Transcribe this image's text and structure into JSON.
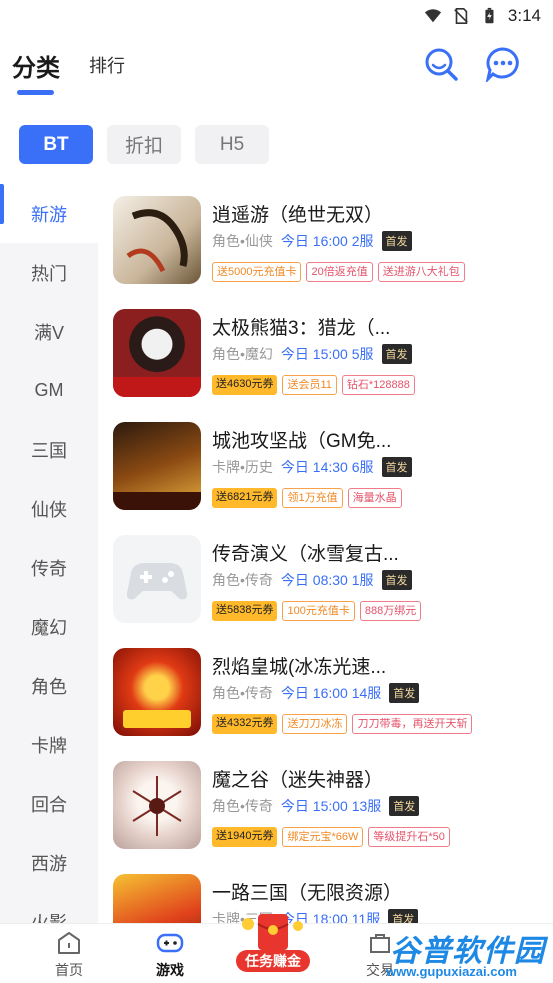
{
  "status_bar": {
    "time": "3:14"
  },
  "header": {
    "active_tab": "分类",
    "second_tab": "排行",
    "search_icon": "search-icon",
    "message_icon": "chat-bubble-icon"
  },
  "filters": [
    {
      "label": "BT",
      "active": true
    },
    {
      "label": "折扣",
      "active": false
    },
    {
      "label": "H5",
      "active": false
    }
  ],
  "categories": [
    "新游",
    "热门",
    "满V",
    "GM",
    "三国",
    "仙侠",
    "传奇",
    "魔幻",
    "角色",
    "卡牌",
    "回合",
    "西游",
    "火影"
  ],
  "active_category": "新游",
  "games": [
    {
      "title": "逍遥游（绝世无双）",
      "category": "角色•仙侠",
      "time": "今日 16:00 2服",
      "badge": "首发",
      "tags": [
        {
          "text": "送5000元充值卡",
          "style": "orange"
        },
        {
          "text": "20倍返充值",
          "style": "red"
        },
        {
          "text": "送进游八大礼包",
          "style": "red"
        }
      ]
    },
    {
      "title": "太极熊猫3：猎龙（...",
      "category": "角色•魔幻",
      "time": "今日 15:00 5服",
      "badge": "首发",
      "tags": [
        {
          "text": "送4630元券",
          "style": "coupon"
        },
        {
          "text": "送会员11",
          "style": "orange"
        },
        {
          "text": "钻石*128888",
          "style": "red"
        }
      ]
    },
    {
      "title": "城池攻坚战（GM免...",
      "category": "卡牌•历史",
      "time": "今日 14:30 6服",
      "badge": "首发",
      "tags": [
        {
          "text": "送6821元券",
          "style": "coupon"
        },
        {
          "text": "领1万充值",
          "style": "orange"
        },
        {
          "text": "海量水晶",
          "style": "red"
        }
      ]
    },
    {
      "title": "传奇演义（冰雪复古...",
      "category": "角色•传奇",
      "time": "今日 08:30 1服",
      "badge": "首发",
      "tags": [
        {
          "text": "送5838元券",
          "style": "coupon"
        },
        {
          "text": "100元充值卡",
          "style": "orange"
        },
        {
          "text": "888万绑元",
          "style": "red"
        }
      ]
    },
    {
      "title": "烈焰皇城(冰冻光速...",
      "category": "角色•传奇",
      "time": "今日 16:00 14服",
      "badge": "首发",
      "tags": [
        {
          "text": "送4332元券",
          "style": "coupon"
        },
        {
          "text": "送刀刀冰冻",
          "style": "orange"
        },
        {
          "text": "刀刀带毒，再送开天斩",
          "style": "red"
        }
      ]
    },
    {
      "title": "魔之谷（迷失神器）",
      "category": "角色•传奇",
      "time": "今日 15:00 13服",
      "badge": "首发",
      "tags": [
        {
          "text": "送1940元券",
          "style": "coupon"
        },
        {
          "text": "绑定元宝*66W",
          "style": "orange"
        },
        {
          "text": "等级提升石*50",
          "style": "red"
        }
      ]
    },
    {
      "title": "一路三国（无限资源）",
      "category": "卡牌•三国",
      "time": "今日 18:00 11服",
      "badge": "首发",
      "tags": []
    }
  ],
  "bottom_nav": {
    "home": "首页",
    "game": "游戏",
    "task": "任务赚金",
    "trade": "交易"
  },
  "watermark": {
    "title": "谷普软件园",
    "url": "www.gupuxiazai.com"
  },
  "colors": {
    "accent": "#3a6ff7",
    "coupon": "#ffb92b",
    "tag_orange": "#f08a24",
    "tag_red": "#e5536a"
  }
}
